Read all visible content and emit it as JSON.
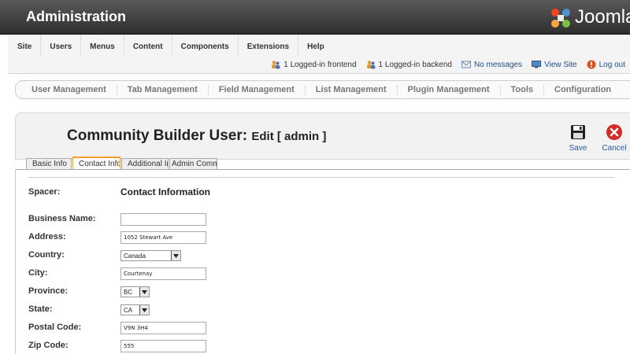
{
  "header": {
    "title": "Administration",
    "logo_text": "Joomla"
  },
  "menu": {
    "items": [
      "Site",
      "Users",
      "Menus",
      "Content",
      "Components",
      "Extensions",
      "Help"
    ]
  },
  "status": {
    "frontend": "1 Logged-in frontend",
    "backend": "1 Logged-in backend",
    "messages": "No messages",
    "view_site": "View Site",
    "logout": "Log out"
  },
  "submenu": {
    "items": [
      "User Management",
      "Tab Management",
      "Field Management",
      "List Management",
      "Plugin Management",
      "Tools",
      "Configuration"
    ]
  },
  "toolbar": {
    "title_main": "Community Builder User:",
    "title_sub": "Edit [ admin ]",
    "save_label": "Save",
    "cancel_label": "Cancel"
  },
  "tabs": [
    "Basic Info",
    "Contact Info",
    "Additional Info",
    "Admin Comments"
  ],
  "active_tab": "Contact Info",
  "form": {
    "spacer_label": "Spacer:",
    "spacer_value": "Contact Information",
    "business_name_label": "Business Name:",
    "business_name_value": "",
    "address_label": "Address:",
    "address_value": "1052 Stewart Ave",
    "country_label": "Country:",
    "country_value": "Canada",
    "city_label": "City:",
    "city_value": "Courtenay",
    "province_label": "Province:",
    "province_value": "BC",
    "state_label": "State:",
    "state_value": "CA",
    "postal_code_label": "Postal Code:",
    "postal_code_value": "V9N 3H4",
    "zip_code_label": "Zip Code:",
    "zip_code_value": "555"
  },
  "colors": {
    "header_bg": "#3a3a3a",
    "link": "#1a4f8a",
    "active_tab_border": "#f0a030",
    "cancel_red": "#d42a2a"
  },
  "icons": {
    "logo": "joomla-logo-icon",
    "frontend": "users-frontend-icon",
    "backend": "users-backend-icon",
    "messages": "envelope-icon",
    "view_site": "monitor-icon",
    "logout": "logout-icon",
    "save": "floppy-disk-icon",
    "cancel": "cancel-circle-icon",
    "dropdown": "chevron-down-icon"
  }
}
